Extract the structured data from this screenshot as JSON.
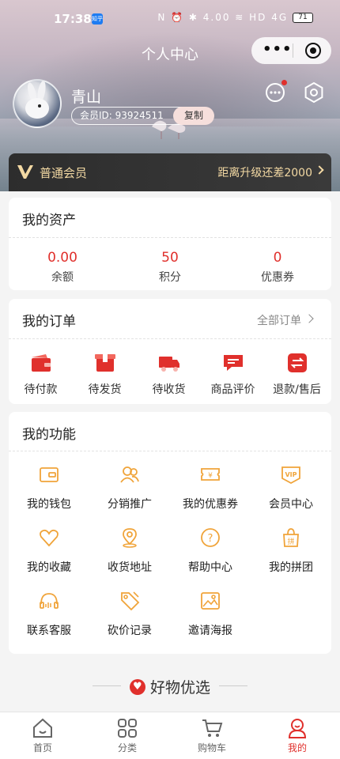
{
  "status_bar": {
    "time": "17:38",
    "app_badge": "知乎",
    "indicators": "N ⏰ ✱ 4.00 ≋ HD 4G",
    "battery": "71"
  },
  "header": {
    "title": "个人中心"
  },
  "profile": {
    "name": "青山",
    "member_id": "会员ID: 93924511",
    "copy_label": "复制"
  },
  "vip": {
    "level": "普通会员",
    "upgrade_tip": "距离升级还差2000"
  },
  "assets": {
    "title": "我的资产",
    "items": [
      {
        "value": "0.00",
        "label": "余额"
      },
      {
        "value": "50",
        "label": "积分"
      },
      {
        "value": "0",
        "label": "优惠券"
      }
    ]
  },
  "orders": {
    "title": "我的订单",
    "all_label": "全部订单",
    "items": [
      {
        "label": "待付款",
        "icon": "wallet-icon"
      },
      {
        "label": "待发货",
        "icon": "box-icon"
      },
      {
        "label": "待收货",
        "icon": "truck-icon"
      },
      {
        "label": "商品评价",
        "icon": "comment-icon"
      },
      {
        "label": "退款/售后",
        "icon": "refund-icon"
      }
    ]
  },
  "functions": {
    "title": "我的功能",
    "items": [
      {
        "label": "我的钱包",
        "icon": "wallet-outline-icon"
      },
      {
        "label": "分销推广",
        "icon": "users-icon"
      },
      {
        "label": "我的优惠券",
        "icon": "coupon-icon"
      },
      {
        "label": "会员中心",
        "icon": "vip-icon"
      },
      {
        "label": "我的收藏",
        "icon": "heart-icon"
      },
      {
        "label": "收货地址",
        "icon": "location-icon"
      },
      {
        "label": "帮助中心",
        "icon": "help-icon"
      },
      {
        "label": "我的拼团",
        "icon": "group-buy-icon"
      },
      {
        "label": "联系客服",
        "icon": "headset-icon"
      },
      {
        "label": "砍价记录",
        "icon": "tag-icon"
      },
      {
        "label": "邀请海报",
        "icon": "poster-icon"
      }
    ]
  },
  "featured": {
    "title": "好物优选"
  },
  "tabbar": {
    "items": [
      {
        "label": "首页",
        "icon": "home-icon"
      },
      {
        "label": "分类",
        "icon": "grid-icon"
      },
      {
        "label": "购物车",
        "icon": "cart-icon"
      },
      {
        "label": "我的",
        "icon": "user-icon",
        "active": true
      }
    ]
  },
  "colors": {
    "accent": "#e0302c",
    "icon_orange": "#f0a43a",
    "vip_gold": "#f3d9a3",
    "vip_dark": "#2d2d2d"
  }
}
